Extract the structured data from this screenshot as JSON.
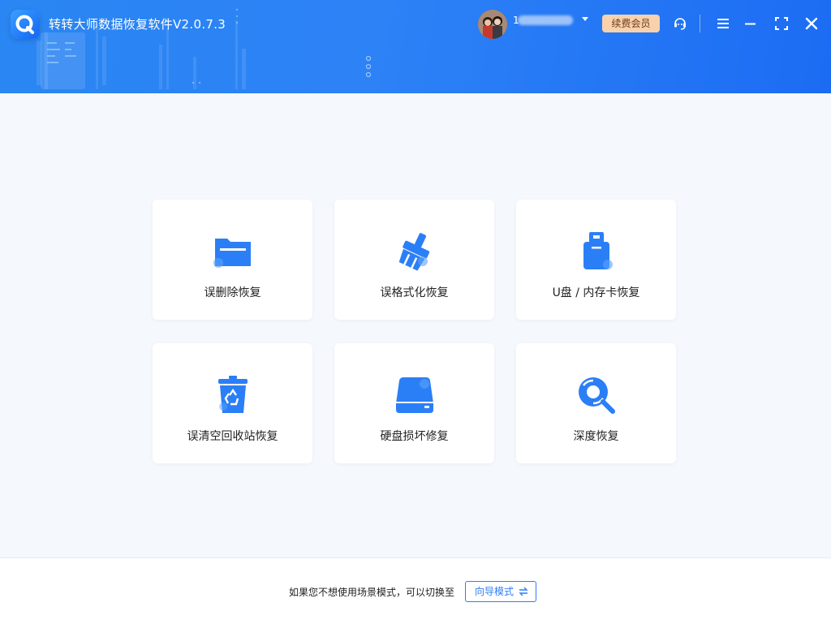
{
  "app": {
    "title": "转转大师数据恢复软件V2.0.7.3"
  },
  "header": {
    "username": "1",
    "vip_button": "续费会员"
  },
  "cards": [
    {
      "label": "误删除恢复",
      "icon": "folder-icon"
    },
    {
      "label": "误格式化恢复",
      "icon": "broom-icon"
    },
    {
      "label": "U盘 / 内存卡恢复",
      "icon": "usb-drive-icon"
    },
    {
      "label": "误清空回收站恢复",
      "icon": "recycle-bin-icon"
    },
    {
      "label": "硬盘损坏修复",
      "icon": "hard-disk-icon"
    },
    {
      "label": "深度恢复",
      "icon": "deep-scan-icon"
    }
  ],
  "footer": {
    "hint": "如果您不想使用场景模式，可以切换至",
    "guide_button": "向导模式"
  },
  "colors": {
    "accent": "#2f7df6",
    "header": "#2a86f2",
    "vip_bg": "#f7d2ad"
  }
}
